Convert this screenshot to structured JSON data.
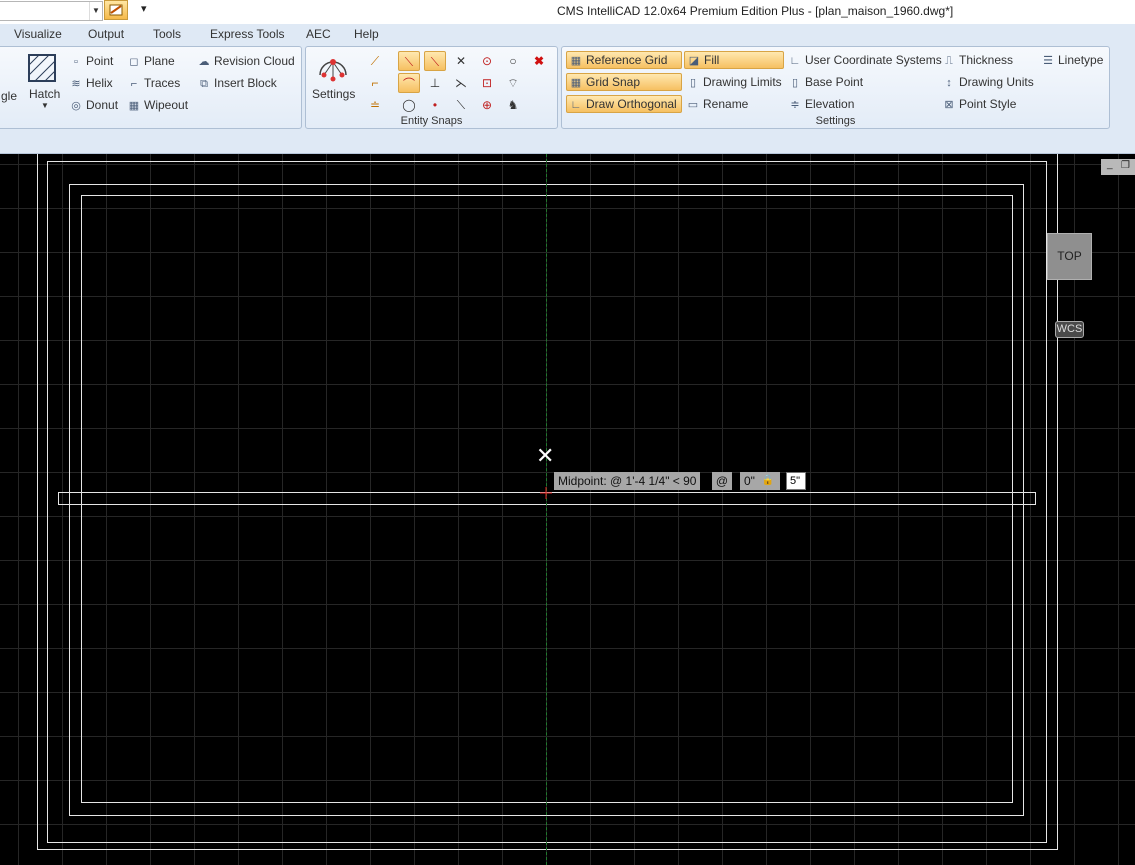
{
  "window": {
    "title": "CMS IntelliCAD 12.0x64 Premium Edition Plus  - [plan_maison_1960.dwg*]",
    "qat_more": "▾"
  },
  "menu": [
    "Visualize",
    "Output",
    "Tools",
    "Express Tools",
    "AEC",
    "Help"
  ],
  "ribbon": {
    "draw": {
      "partial_label": "gle",
      "hatch_label": "Hatch",
      "items": [
        "Point",
        "Helix",
        "Donut",
        "Plane",
        "Traces",
        "Wipeout",
        "Revision Cloud",
        "Insert Block"
      ]
    },
    "entity_snaps": {
      "settings_label": "Settings",
      "group_label": "Entity Snaps"
    },
    "settings": {
      "group_label": "Settings",
      "items": [
        "Reference Grid",
        "Grid Snap",
        "Draw Orthogonal",
        "Fill",
        "Drawing Limits",
        "Rename",
        "User Coordinate Systems",
        "Base Point",
        "Elevation",
        "Thickness",
        "Drawing Units",
        "Point Style",
        "Linetype"
      ]
    }
  },
  "canvas": {
    "snap_tooltip": "Midpoint: @ 1'-4 1/4\" < 90",
    "at_label": "@",
    "angle_value": "0\"",
    "input_value": "5\"",
    "viewcube_face": "TOP",
    "ucs_label": "WCS"
  },
  "colors": {
    "snap_active": "#f6c062",
    "canvas_bg": "#000000",
    "crosshair": "#1f7a2c",
    "grid": "#262626"
  }
}
